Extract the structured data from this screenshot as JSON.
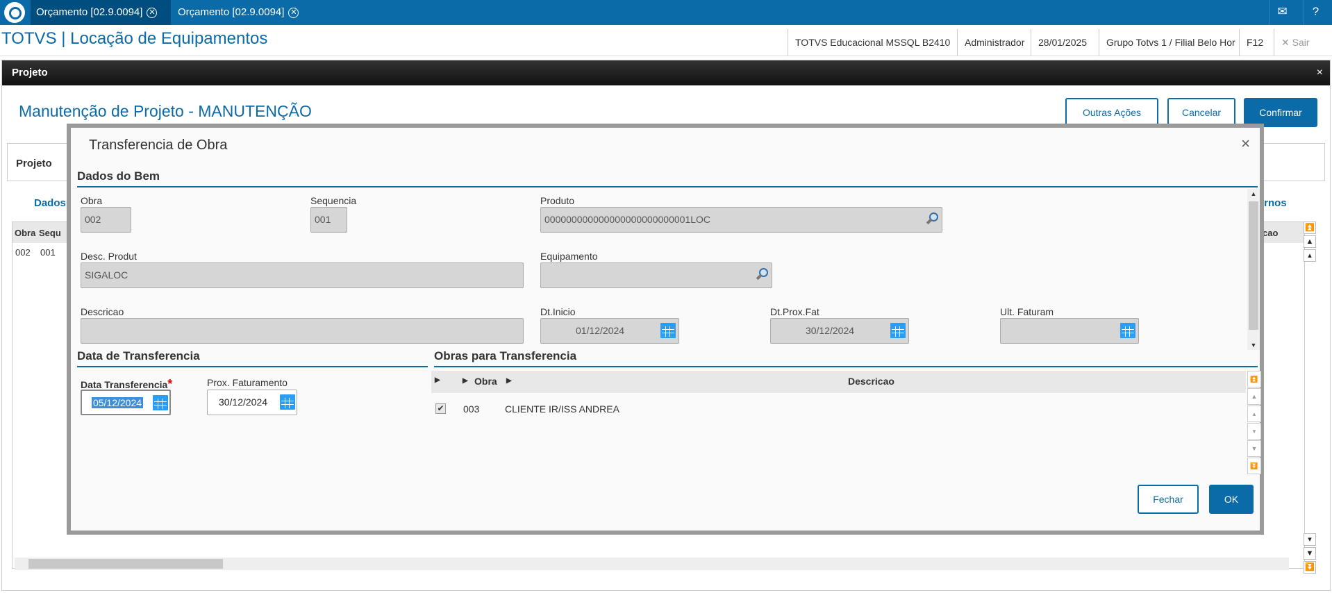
{
  "topbar": {
    "tabs": [
      {
        "label": "Orçamento [02.9.0094]"
      },
      {
        "label": "Orçamento [02.9.0094]"
      }
    ],
    "close_glyph": "✕",
    "mail_icon": "✉",
    "help_icon": "?"
  },
  "header": {
    "app_title": "TOTVS | Locação de Equipamentos",
    "environment": "TOTVS Educacional MSSQL B2410",
    "user": "Administrador",
    "date": "28/01/2025",
    "branch": "Grupo Totvs 1 / Filial Belo Hor",
    "shortcut": "F12",
    "logout": "✕  Sair"
  },
  "panel": {
    "title": "Projeto",
    "close": "×",
    "page_title": "Manutenção de Projeto - MANUTENÇÃO",
    "buttons": {
      "more_actions": "Outras Ações",
      "cancel": "Cancelar",
      "confirm": "Confirmar"
    },
    "bg_section": "Projeto",
    "bg_tab_left": "Dados",
    "bg_tab_right": "urnos",
    "bg_grid": {
      "col_obra": "Obra",
      "col_seq": "Sequ",
      "col_right": "cao",
      "obra": "002",
      "seq": "001"
    }
  },
  "modal": {
    "title": "Transferencia de Obra",
    "close": "×",
    "dados_do_bem": {
      "section": "Dados do Bem",
      "obra": {
        "label": "Obra",
        "value": "002"
      },
      "sequencia": {
        "label": "Sequencia",
        "value": "001"
      },
      "produto": {
        "label": "Produto",
        "value": "000000000000000000000000001LOC"
      },
      "desc_produt": {
        "label": "Desc. Produt",
        "value": "SIGALOC"
      },
      "equipamento": {
        "label": "Equipamento",
        "value": ""
      },
      "descricao": {
        "label": "Descricao",
        "value": ""
      },
      "dt_inicio": {
        "label": "Dt.Inicio",
        "value": "01/12/2024"
      },
      "dt_prox_fat": {
        "label": "Dt.Prox.Fat",
        "value": "30/12/2024"
      },
      "ult_faturam": {
        "label": "Ult. Faturam",
        "value": "  /  /"
      }
    },
    "data_transferencia": {
      "section": "Data de Transferencia",
      "data_transferencia": {
        "label": "Data Transferencia",
        "required": "*",
        "value": "05/12/2024"
      },
      "prox_faturamento": {
        "label": "Prox. Faturamento",
        "value": "30/12/2024"
      }
    },
    "obras": {
      "section": "Obras para Transferencia",
      "columns": {
        "obra": "Obra",
        "descricao": "Descricao"
      },
      "rows": [
        {
          "checked": "✔",
          "obra": "003",
          "descricao": "CLIENTE IR/ISS ANDREA"
        }
      ]
    },
    "buttons": {
      "close": "Fechar",
      "ok": "OK"
    }
  },
  "colors": {
    "accent": "#0b6aa8",
    "topbar": "#0b6aa8",
    "calendar": "#2a9df4"
  }
}
